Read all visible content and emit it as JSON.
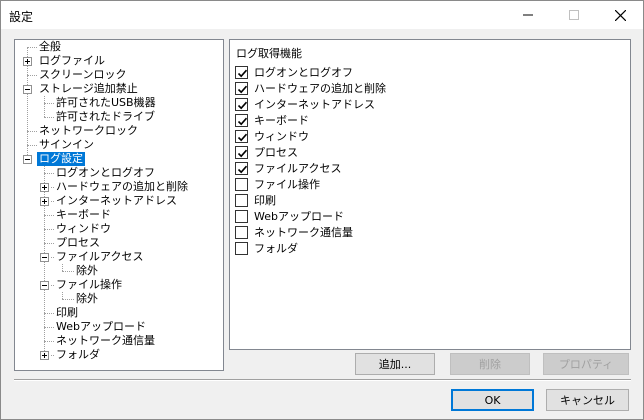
{
  "window": {
    "title": "設定"
  },
  "titlebar": {
    "minimize_icon": "minimize-icon",
    "maximize_icon": "maximize-icon",
    "close_icon": "close-icon"
  },
  "tree": {
    "items": [
      {
        "label": "全般"
      },
      {
        "label": "ログファイル"
      },
      {
        "label": "スクリーンロック"
      },
      {
        "label": "ストレージ追加禁止"
      },
      {
        "label": "許可されたUSB機器"
      },
      {
        "label": "許可されたドライブ"
      },
      {
        "label": "ネットワークロック"
      },
      {
        "label": "サインイン"
      },
      {
        "label": "ログ設定"
      },
      {
        "label": "ログオンとログオフ"
      },
      {
        "label": "ハードウェアの追加と削除"
      },
      {
        "label": "インターネットアドレス"
      },
      {
        "label": "キーボード"
      },
      {
        "label": "ウィンドウ"
      },
      {
        "label": "プロセス"
      },
      {
        "label": "ファイルアクセス"
      },
      {
        "label": "除外"
      },
      {
        "label": "ファイル操作"
      },
      {
        "label": "除外"
      },
      {
        "label": "印刷"
      },
      {
        "label": "Webアップロード"
      },
      {
        "label": "ネットワーク通信量"
      },
      {
        "label": "フォルダ"
      }
    ],
    "selected": "ログ設定"
  },
  "panel": {
    "title": "ログ取得機能",
    "checkboxes": [
      {
        "label": "ログオンとログオフ",
        "checked": true
      },
      {
        "label": "ハードウェアの追加と削除",
        "checked": true
      },
      {
        "label": "インターネットアドレス",
        "checked": true
      },
      {
        "label": "キーボード",
        "checked": true
      },
      {
        "label": "ウィンドウ",
        "checked": true
      },
      {
        "label": "プロセス",
        "checked": true
      },
      {
        "label": "ファイルアクセス",
        "checked": true
      },
      {
        "label": "ファイル操作",
        "checked": false
      },
      {
        "label": "印刷",
        "checked": false
      },
      {
        "label": "Webアップロード",
        "checked": false
      },
      {
        "label": "ネットワーク通信量",
        "checked": false
      },
      {
        "label": "フォルダ",
        "checked": false
      }
    ]
  },
  "buttons": {
    "add": "追加...",
    "delete": "削除",
    "properties": "プロパティ",
    "ok": "OK",
    "cancel": "キャンセル"
  },
  "colors": {
    "selection": "#0078d7",
    "background": "#f0f0f0"
  }
}
